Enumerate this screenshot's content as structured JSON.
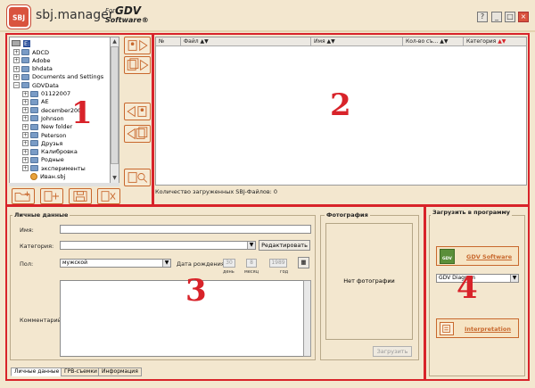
{
  "app": {
    "name": "sbj.manager",
    "logo_text": "SBJ",
    "for": "For",
    "gdv": "GDV",
    "software": "Software®"
  },
  "window_buttons": {
    "help": "?",
    "minimize": "_",
    "maximize": "□",
    "close": "×"
  },
  "regions": {
    "r1": "1",
    "r2": "2",
    "r3": "3",
    "r4": "4"
  },
  "tree": {
    "root": "E:",
    "items": [
      {
        "label": "ADCD",
        "level": 1
      },
      {
        "label": "Adobe",
        "level": 1
      },
      {
        "label": "bhdata",
        "level": 1
      },
      {
        "label": "Documents and Settings",
        "level": 1
      },
      {
        "label": "GDVData",
        "level": 1,
        "expanded": true
      },
      {
        "label": "01122007",
        "level": 2
      },
      {
        "label": "AE",
        "level": 2
      },
      {
        "label": "december2007",
        "level": 2
      },
      {
        "label": "Johnson",
        "level": 2
      },
      {
        "label": "New folder",
        "level": 2
      },
      {
        "label": "Peterson",
        "level": 2
      },
      {
        "label": "Друзья",
        "level": 2
      },
      {
        "label": "Калибровка",
        "level": 2
      },
      {
        "label": "Родные",
        "level": 2
      },
      {
        "label": "эксперименты",
        "level": 2
      },
      {
        "label": "Иван.sbj",
        "level": 2,
        "file": true
      }
    ]
  },
  "grid": {
    "columns": [
      "№",
      "Файл",
      "Имя",
      "Кол-во съ...",
      "Категория"
    ],
    "status": "Количество загруженных SBJ-Файлов: 0"
  },
  "personal": {
    "group_title": "Личные данные",
    "name_label": "Имя:",
    "category_label": "Категория:",
    "edit_button": "Редактировать",
    "gender_label": "Пол:",
    "gender_value": "мужской",
    "birth_label": "Дата рождения:",
    "day_value": "30",
    "month_value": "8",
    "year_value": "1989",
    "day_label": "день",
    "month_label": "месяц",
    "year_label": "год",
    "comment_label": "Комментарий"
  },
  "photo": {
    "group_title": "Фотография",
    "empty_text": "Нет фотографии",
    "upload_button": "Загрузить"
  },
  "tabs": [
    "Личные данные",
    "ГРВ-съемки",
    "Информация"
  ],
  "load": {
    "group_title": "Загрузить в программу",
    "gdv_software": "GDV Software",
    "gdv_icon_text": "GDV",
    "diagram_value": "GDV Diagram",
    "interpretation": "Interpretation"
  },
  "colors": {
    "accent": "#d8232a",
    "button_border": "#c8682d",
    "background": "#f3e7cf"
  }
}
